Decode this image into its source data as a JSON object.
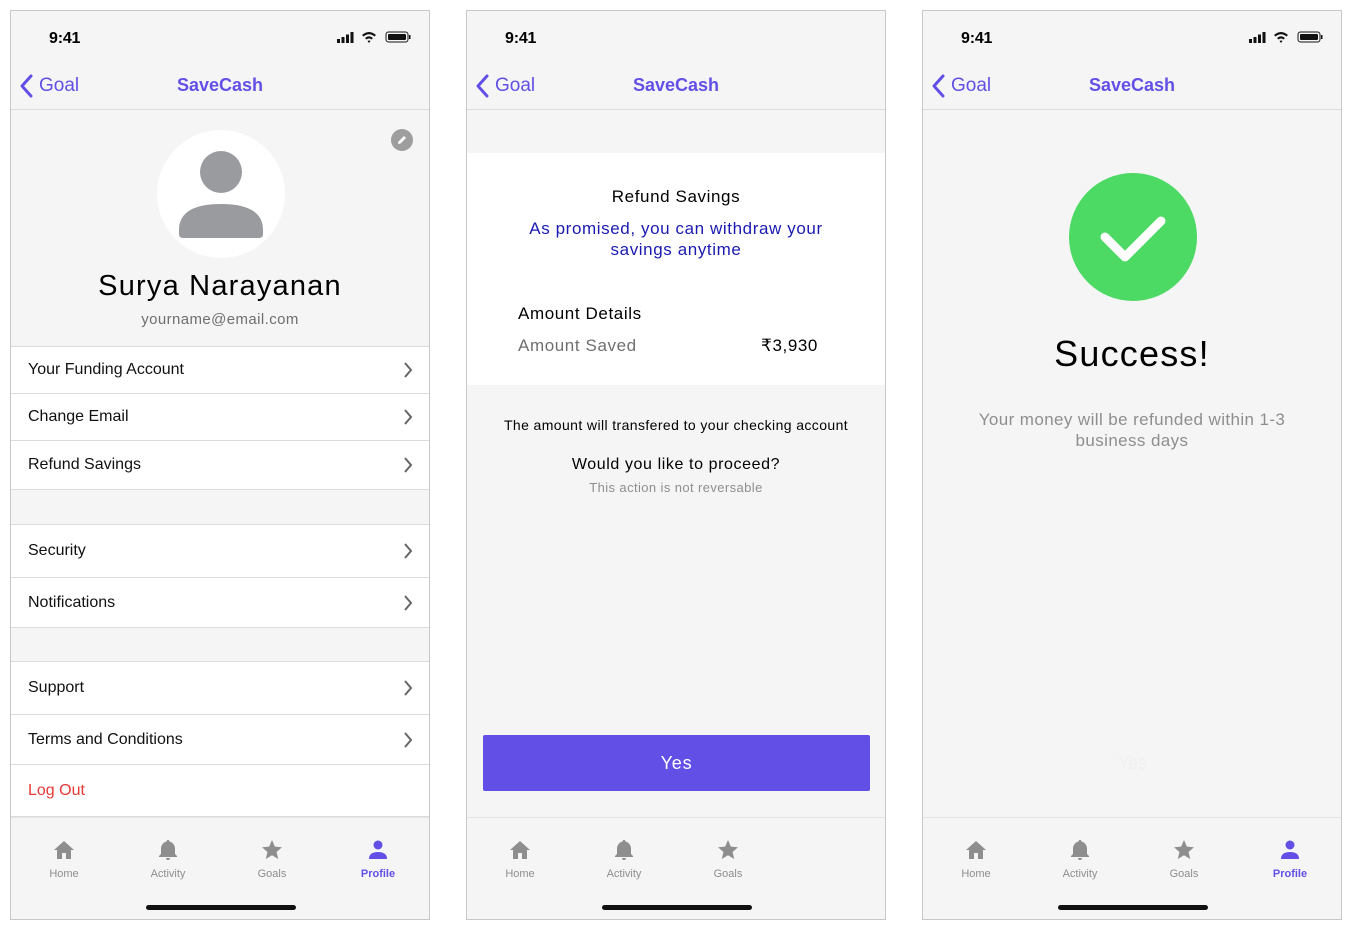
{
  "status_time": "9:41",
  "nav": {
    "back_label": "Goal",
    "app_title": "SaveCash"
  },
  "tabs": [
    {
      "label": "Home",
      "icon": "home-icon"
    },
    {
      "label": "Activity",
      "icon": "bell-icon"
    },
    {
      "label": "Goals",
      "icon": "star-icon"
    },
    {
      "label": "Profile",
      "icon": "person-icon"
    }
  ],
  "colors": {
    "accent": "#6250e6",
    "success": "#4cd964",
    "danger": "#e53935",
    "link_blue": "#1a1ab0"
  },
  "profile": {
    "name": "Surya Narayanan",
    "email": "yourname@email.com",
    "group1": [
      "Your Funding Account",
      "Change Email",
      "Refund Savings"
    ],
    "group2": [
      "Security",
      "Notifications"
    ],
    "group3": [
      "Support",
      "Terms and Conditions"
    ],
    "logout": "Log Out"
  },
  "refund": {
    "title": "Refund Savings",
    "subtitle": "As promised, you can withdraw your savings anytime",
    "details_heading": "Amount Details",
    "amount_label": "Amount Saved",
    "amount_value": "₹3,930",
    "transfer_note": "The amount will transfered to your checking account",
    "proceed_question": "Would you like to proceed?",
    "irreversible_note": "This action is not reversable",
    "yes_label": "Yes"
  },
  "success": {
    "title": "Success!",
    "message": "Your money will be refunded within 1-3 business days",
    "ghost_label": "Yes"
  }
}
